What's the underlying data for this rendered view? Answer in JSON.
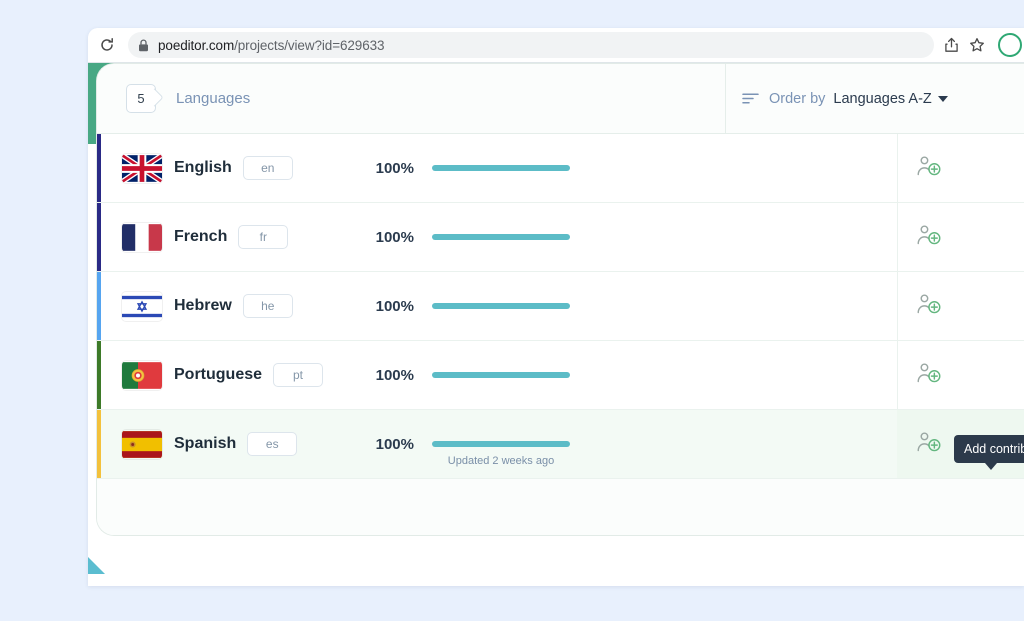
{
  "browser": {
    "reload_icon": "reload-icon",
    "lock_icon": "lock-icon",
    "url_prefix": "poeditor.com",
    "url_suffix": "/projects/view?id=629633",
    "share_icon": "share-icon",
    "bookmark_icon": "star-icon",
    "avatar": "profile-avatar"
  },
  "card": {
    "header": {
      "count": "5",
      "count_label": "Languages",
      "sort_icon": "sort-icon",
      "orderby_label": "Order by",
      "orderby_value": "Languages A-Z",
      "caret_icon": "chevron-down-icon"
    },
    "rows": [
      {
        "flag": "flag-gb",
        "name": "English",
        "code": "en",
        "percent": "100%",
        "progress": 100,
        "accent": "#2a2a86",
        "sub": "",
        "contrib_icon": "add-contributor-icon",
        "highlighted": false
      },
      {
        "flag": "flag-fr",
        "name": "French",
        "code": "fr",
        "percent": "100%",
        "progress": 100,
        "accent": "#2a2a86",
        "sub": "",
        "contrib_icon": "add-contributor-icon",
        "highlighted": false
      },
      {
        "flag": "flag-il",
        "name": "Hebrew",
        "code": "he",
        "percent": "100%",
        "progress": 100,
        "accent": "#56a5f0",
        "sub": "",
        "contrib_icon": "add-contributor-icon",
        "highlighted": false
      },
      {
        "flag": "flag-pt",
        "name": "Portuguese",
        "code": "pt",
        "percent": "100%",
        "progress": 100,
        "accent": "#3d7a28",
        "sub": "",
        "contrib_icon": "add-contributor-icon",
        "highlighted": false
      },
      {
        "flag": "flag-es",
        "name": "Spanish",
        "code": "es",
        "percent": "100%",
        "progress": 100,
        "accent": "#f3c13c",
        "sub": "Updated 2 weeks ago",
        "contrib_icon": "add-contributor-icon",
        "highlighted": true
      }
    ]
  },
  "tooltip": {
    "text": "Add contrib"
  },
  "colors": {
    "page_background": "#e8f0fd",
    "progress_bar": "#5cbcc7",
    "header_accent": "#48a884",
    "corner_triangle": "#5bbdd0",
    "tooltip_background": "#2c3a4b",
    "highlight_row": "#f3faf5"
  }
}
